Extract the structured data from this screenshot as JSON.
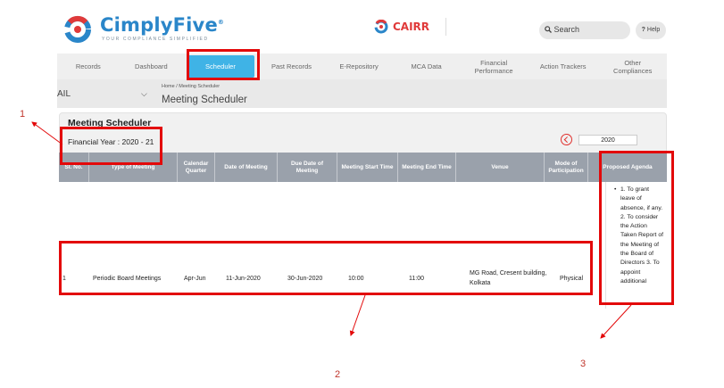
{
  "header": {
    "logo_text": "CimplyFive",
    "logo_registered": "®",
    "logo_tagline": "YOUR COMPLIANCE SIMPLIFIED",
    "cairr_text": "CAIRR",
    "search_label": "Search",
    "help_label": "Help"
  },
  "nav": {
    "items": [
      {
        "label": "Records"
      },
      {
        "label": "Dashboard"
      },
      {
        "label": "Scheduler"
      },
      {
        "label": "Past Records"
      },
      {
        "label": "E-Repository"
      },
      {
        "label": "MCA Data"
      },
      {
        "label": "Financial\nPerformance"
      },
      {
        "label": "Action Trackers"
      },
      {
        "label": "Other\nCompliances"
      }
    ],
    "active": "Scheduler"
  },
  "company_select": {
    "value": "AIL"
  },
  "breadcrumb": {
    "home": "Home",
    "separator": "/",
    "current": "Meeting Scheduler",
    "title": "Meeting Scheduler"
  },
  "panel": {
    "title": "Meeting Scheduler",
    "financial_year": "Financial Year : 2020 - 21",
    "year_value": "2020"
  },
  "table": {
    "columns": [
      "Sl. No.",
      "Type of Meeting",
      "Calendar\nQuarter",
      "Date of Meeting",
      "Due Date of\nMeeting",
      "Meeting Start Time",
      "Meeting End Time",
      "Venue",
      "Mode of\nParticipation",
      "Proposed Agenda"
    ],
    "rows": [
      {
        "sl": "1",
        "type": "Periodic Board Meetings",
        "quarter": "Apr-Jun",
        "date": "11-Jun-2020",
        "due_date": "30-Jun-2020",
        "start": "10:00",
        "end": "11:00",
        "venue_line1": "MG Road, Cresent building,",
        "venue_line2": "Kolkata",
        "mode": "Physical",
        "agenda": "1. To grant leave of absence, if any. 2. To consider the Action Taken Report of the Meeting of the Board of Directors 3. To appoint additional"
      }
    ]
  },
  "annotations": {
    "label1": "1",
    "label2": "2",
    "label3": "3"
  },
  "colors": {
    "highlight": "#e3090a",
    "nav_active": "#3fb3e6",
    "table_header": "#9aa1ab",
    "brand_blue": "#2a86c9",
    "brand_red": "#e03a3a"
  }
}
